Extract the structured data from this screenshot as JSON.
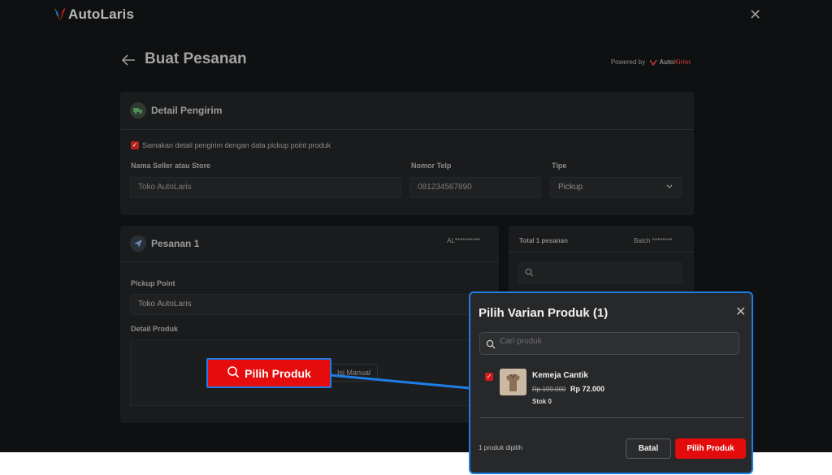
{
  "app": {
    "logo_text": "AutoLaris"
  },
  "header": {
    "title": "Buat Pesanan",
    "powered_label": "Powered by",
    "powered_brand_a": "Auto",
    "powered_brand_b": "Kirim"
  },
  "sender": {
    "title": "Detail Pengirim",
    "same_as_pickup_label": "Samakan detail pengirim dengan data pickup point produk",
    "seller_label": "Nama Seller atau Store",
    "seller_value": "Toko AutoLaris",
    "phone_label": "Nomor Telp",
    "phone_value": "081234567890",
    "type_label": "Tipe",
    "type_value": "Pickup"
  },
  "order": {
    "title": "Pesanan 1",
    "code": "AL**********",
    "pickup_label": "Pickup Point",
    "pickup_value": "Toko AutoLaris",
    "product_label": "Detail Produk",
    "manual_button": "Isi Manual"
  },
  "summary": {
    "total_label": "Total 1 pesanan",
    "batch_label": "Batch ********"
  },
  "modal": {
    "title": "Pilih Varian Produk (1)",
    "search_placeholder": "Cari produk",
    "product_name": "Kemeja Cantik",
    "price_old": "Rp 199.000",
    "price_new": "Rp 72.000",
    "stock": "Stok 0",
    "selected_count": "1 produk dipilih",
    "cancel_button": "Batal",
    "confirm_button": "Pilih Produk"
  },
  "callout": {
    "label": "Pilih Produk"
  },
  "colors": {
    "accent_red": "#e30b0b",
    "highlight_blue": "#1e7ee8",
    "background": "#0f1011"
  }
}
